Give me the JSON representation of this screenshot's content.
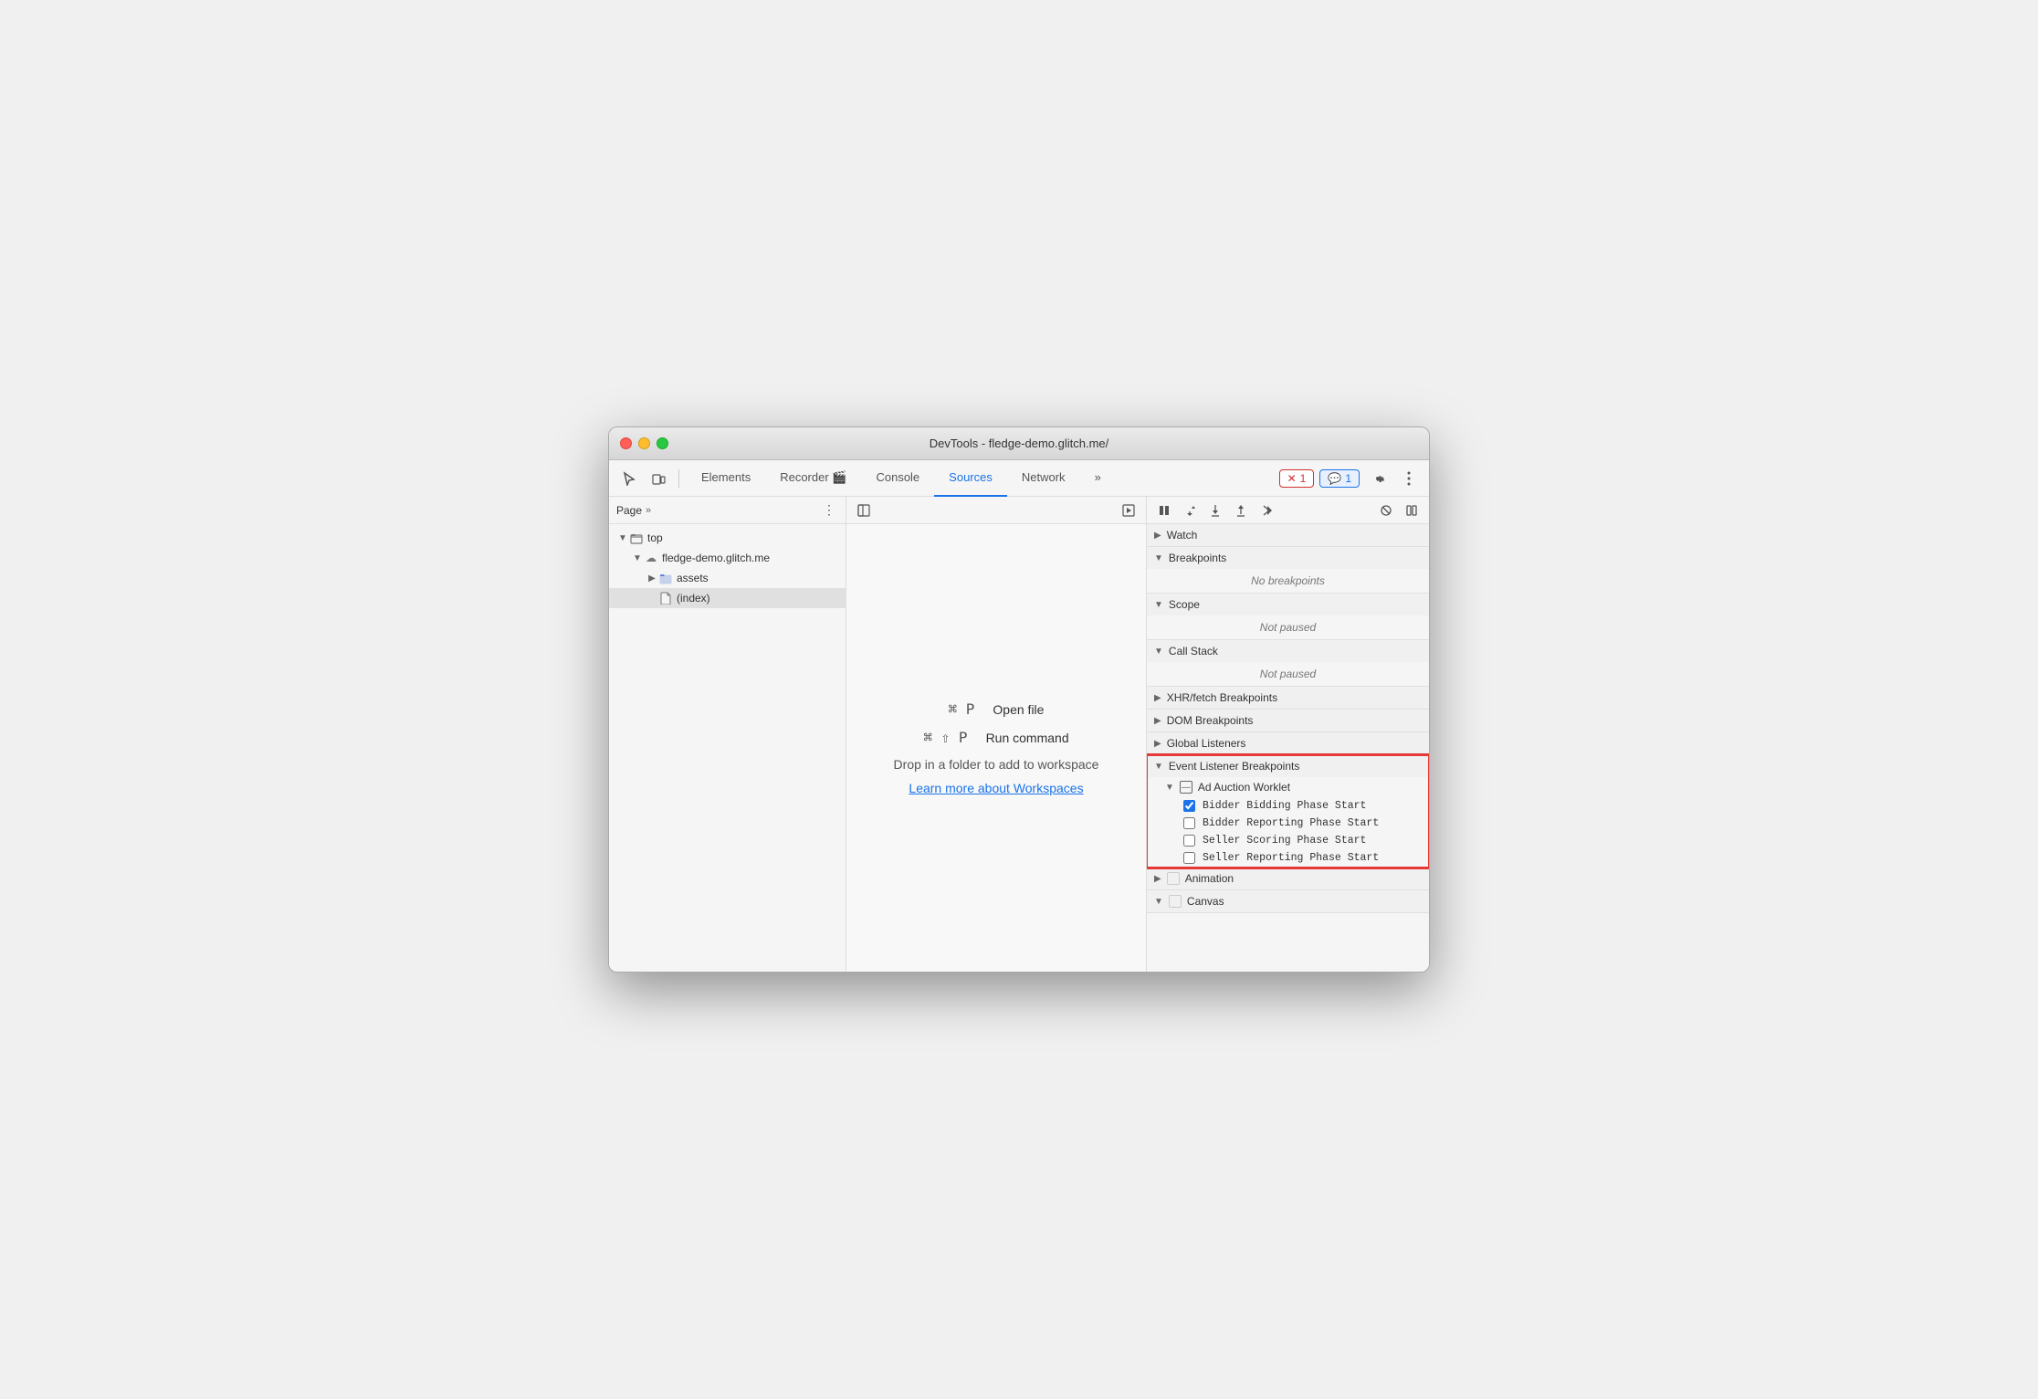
{
  "window": {
    "title": "DevTools - fledge-demo.glitch.me/"
  },
  "toolbar": {
    "tabs": [
      {
        "id": "elements",
        "label": "Elements",
        "active": false
      },
      {
        "id": "recorder",
        "label": "Recorder 🎬",
        "active": false
      },
      {
        "id": "console",
        "label": "Console",
        "active": false
      },
      {
        "id": "sources",
        "label": "Sources",
        "active": true
      },
      {
        "id": "network",
        "label": "Network",
        "active": false
      }
    ],
    "more_tabs": "»",
    "error_count": "1",
    "info_count": "1"
  },
  "left_panel": {
    "header": "Page",
    "more_icon": "»",
    "tree": [
      {
        "indent": 0,
        "arrow": "▼",
        "icon": "folder",
        "label": "top",
        "level": 0
      },
      {
        "indent": 1,
        "arrow": "▼",
        "icon": "cloud",
        "label": "fledge-demo.glitch.me",
        "level": 1
      },
      {
        "indent": 2,
        "arrow": "▶",
        "icon": "folder-blue",
        "label": "assets",
        "level": 2
      },
      {
        "indent": 2,
        "arrow": "",
        "icon": "file",
        "label": "(index)",
        "level": 2,
        "selected": true
      }
    ]
  },
  "middle_panel": {
    "shortcut1_key": "⌘ P",
    "shortcut1_label": "Open file",
    "shortcut2_key": "⌘ ⇧ P",
    "shortcut2_label": "Run command",
    "drop_text": "Drop in a folder to add to workspace",
    "workspace_link": "Learn more about Workspaces"
  },
  "right_panel": {
    "sections": [
      {
        "id": "watch",
        "label": "Watch",
        "collapsed": true,
        "content": null
      },
      {
        "id": "breakpoints",
        "label": "Breakpoints",
        "collapsed": false,
        "content": "No breakpoints"
      },
      {
        "id": "scope",
        "label": "Scope",
        "collapsed": false,
        "content": "Not paused"
      },
      {
        "id": "call-stack",
        "label": "Call Stack",
        "collapsed": false,
        "content": "Not paused"
      },
      {
        "id": "xhr-fetch",
        "label": "XHR/fetch Breakpoints",
        "collapsed": true,
        "content": null
      },
      {
        "id": "dom",
        "label": "DOM Breakpoints",
        "collapsed": true,
        "content": null
      },
      {
        "id": "global-listeners",
        "label": "Global Listeners",
        "collapsed": true,
        "content": null
      },
      {
        "id": "event-listener",
        "label": "Event Listener Breakpoints",
        "collapsed": false,
        "highlighted": true,
        "content": null
      }
    ],
    "event_listener_section": {
      "sub_sections": [
        {
          "label": "Ad Auction Worklet",
          "checkboxes": [
            {
              "id": "bidder-bidding",
              "label": "Bidder Bidding Phase Start",
              "checked": true
            },
            {
              "id": "bidder-reporting",
              "label": "Bidder Reporting Phase Start",
              "checked": false
            },
            {
              "id": "seller-scoring",
              "label": "Seller Scoring Phase Start",
              "checked": false
            },
            {
              "id": "seller-reporting",
              "label": "Seller Reporting Phase Start",
              "checked": false
            }
          ]
        }
      ],
      "additional_sections": [
        {
          "label": "Animation",
          "collapsed": true
        },
        {
          "label": "Canvas",
          "collapsed": false
        }
      ]
    }
  }
}
